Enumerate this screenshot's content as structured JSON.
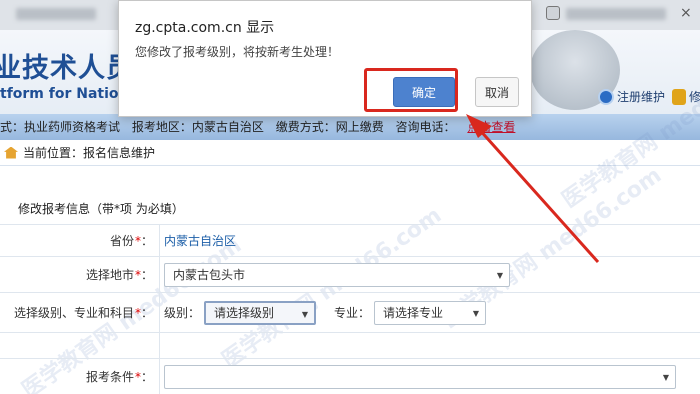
{
  "dialog": {
    "title": "zg.cpta.com.cn 显示",
    "message": "您修改了报考级别，将按新考生处理！",
    "ok_label": "确定",
    "cancel_label": "取消"
  },
  "header": {
    "title_cn": "业技术人员",
    "title_en": "tform for National",
    "links": [
      "注册维护",
      "修"
    ]
  },
  "info_bar": {
    "items": [
      "式：执业药师资格考试",
      "报考地区：内蒙古自治区",
      "缴费方式：网上缴费",
      "咨询电话："
    ],
    "link_label": "点击查看"
  },
  "breadcrumb": {
    "text": "当前位置：报名信息维护"
  },
  "form": {
    "section_title": "修改报考信息（带*项 为必填）",
    "province_label": "省份",
    "province_value": "内蒙古自治区",
    "city_label": "选择地市",
    "city_value": "内蒙古包头市",
    "level_row_label": "选择级别、专业和科目",
    "level_label": "级别：",
    "level_value": "请选择级别",
    "major_label": "专业：",
    "major_value": "请选择专业",
    "condition_label": "报考条件"
  },
  "watermark": {
    "text": "医学教育网 med66.com"
  },
  "colors": {
    "accent": "#4d82cf",
    "highlight": "#d9281e",
    "link": "#c0102a"
  }
}
